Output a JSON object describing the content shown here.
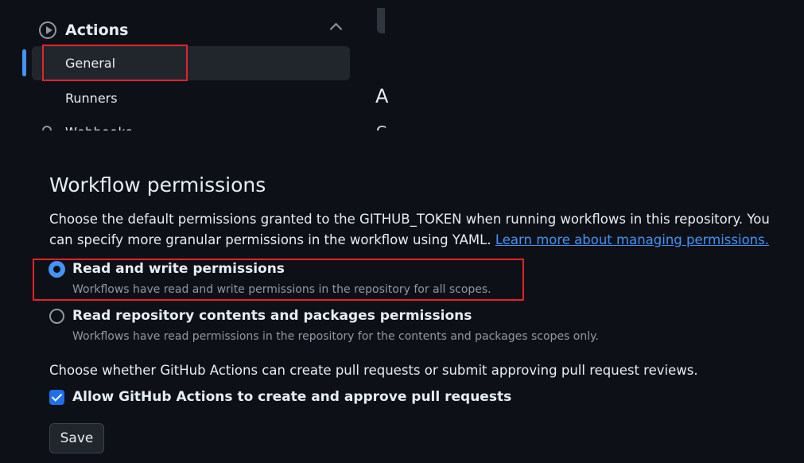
{
  "sidebar": {
    "section_title": "Actions",
    "items": [
      {
        "label": "General",
        "active": true
      },
      {
        "label": "Runners",
        "active": false
      },
      {
        "label": "Webhooks",
        "active": false
      }
    ],
    "section_icon": "play-circle-icon",
    "collapse_icon": "chevron-up-icon"
  },
  "main_partial": {
    "letter_1": "A",
    "letter_2": "G"
  },
  "workflow_permissions": {
    "heading": "Workflow permissions",
    "description_prefix": "Choose the default permissions granted to the GITHUB_TOKEN when running workflows in this repository. You can specify more granular permissions in the workflow using YAML.",
    "learn_more_link": "Learn more about managing permissions.",
    "options": [
      {
        "title": "Read and write permissions",
        "note": "Workflows have read and write permissions in the repository for all scopes.",
        "selected": true
      },
      {
        "title": "Read repository contents and packages permissions",
        "note": "Workflows have read permissions in the repository for the contents and packages scopes only.",
        "selected": false
      }
    ],
    "pr_note": "Choose whether GitHub Actions can create pull requests or submit approving pull request reviews.",
    "allow_pr_label": "Allow GitHub Actions to create and approve pull requests",
    "allow_pr_checked": true,
    "save_label": "Save"
  },
  "colors": {
    "background": "#0d1117",
    "accent": "#4493f8",
    "highlight": "#e5222a"
  }
}
